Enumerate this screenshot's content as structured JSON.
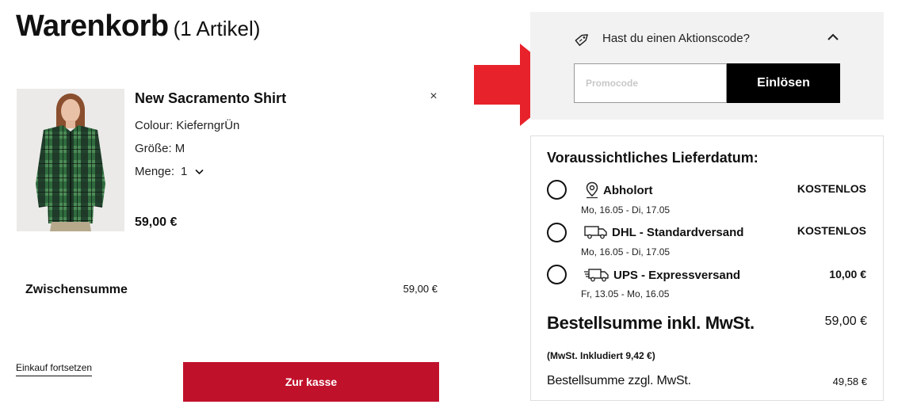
{
  "cart": {
    "title": "Warenkorb",
    "count_label": "(1 Artikel)"
  },
  "item": {
    "name": "New Sacramento Shirt",
    "colour_label": "Colour:",
    "colour_value": "KieferngrÜn",
    "size_label": "Größe:",
    "size_value": "M",
    "qty_label": "Menge:",
    "qty_value": "1",
    "price": "59,00 €",
    "remove_icon": "×"
  },
  "subtotal": {
    "label": "Zwischensumme",
    "value": "59,00 €"
  },
  "actions": {
    "continue_label": "Einkauf fortsetzen",
    "checkout_label": "Zur kasse"
  },
  "promo": {
    "question": "Hast du einen Aktionscode?",
    "placeholder": "Promocode",
    "redeem_label": "Einlösen"
  },
  "delivery": {
    "title": "Voraussichtliches Lieferdatum:",
    "options": [
      {
        "icon": "location-pin-icon",
        "name": "Abholort",
        "date": "Mo, 16.05 - Di, 17.05",
        "price": "KOSTENLOS"
      },
      {
        "icon": "truck-icon",
        "name": "DHL - Standardversand",
        "date": "Mo, 16.05 - Di, 17.05",
        "price": "KOSTENLOS"
      },
      {
        "icon": "express-truck-icon",
        "name": "UPS - Expressversand",
        "date": "Fr, 13.05 - Mo, 16.05",
        "price": "10,00 €"
      }
    ]
  },
  "totals": {
    "total_label": "Bestellsumme inkl. MwSt.",
    "total_value": "59,00 €",
    "vat_note": "(MwSt. Inkludiert 9,42 €)",
    "net_label": "Bestellsumme zzgl. MwSt.",
    "net_value": "49,58 €"
  },
  "colors": {
    "checkout": "#c0112b",
    "arrow": "#e8222a",
    "redeem": "#000000",
    "promo_panel": "#f2f2f2"
  }
}
